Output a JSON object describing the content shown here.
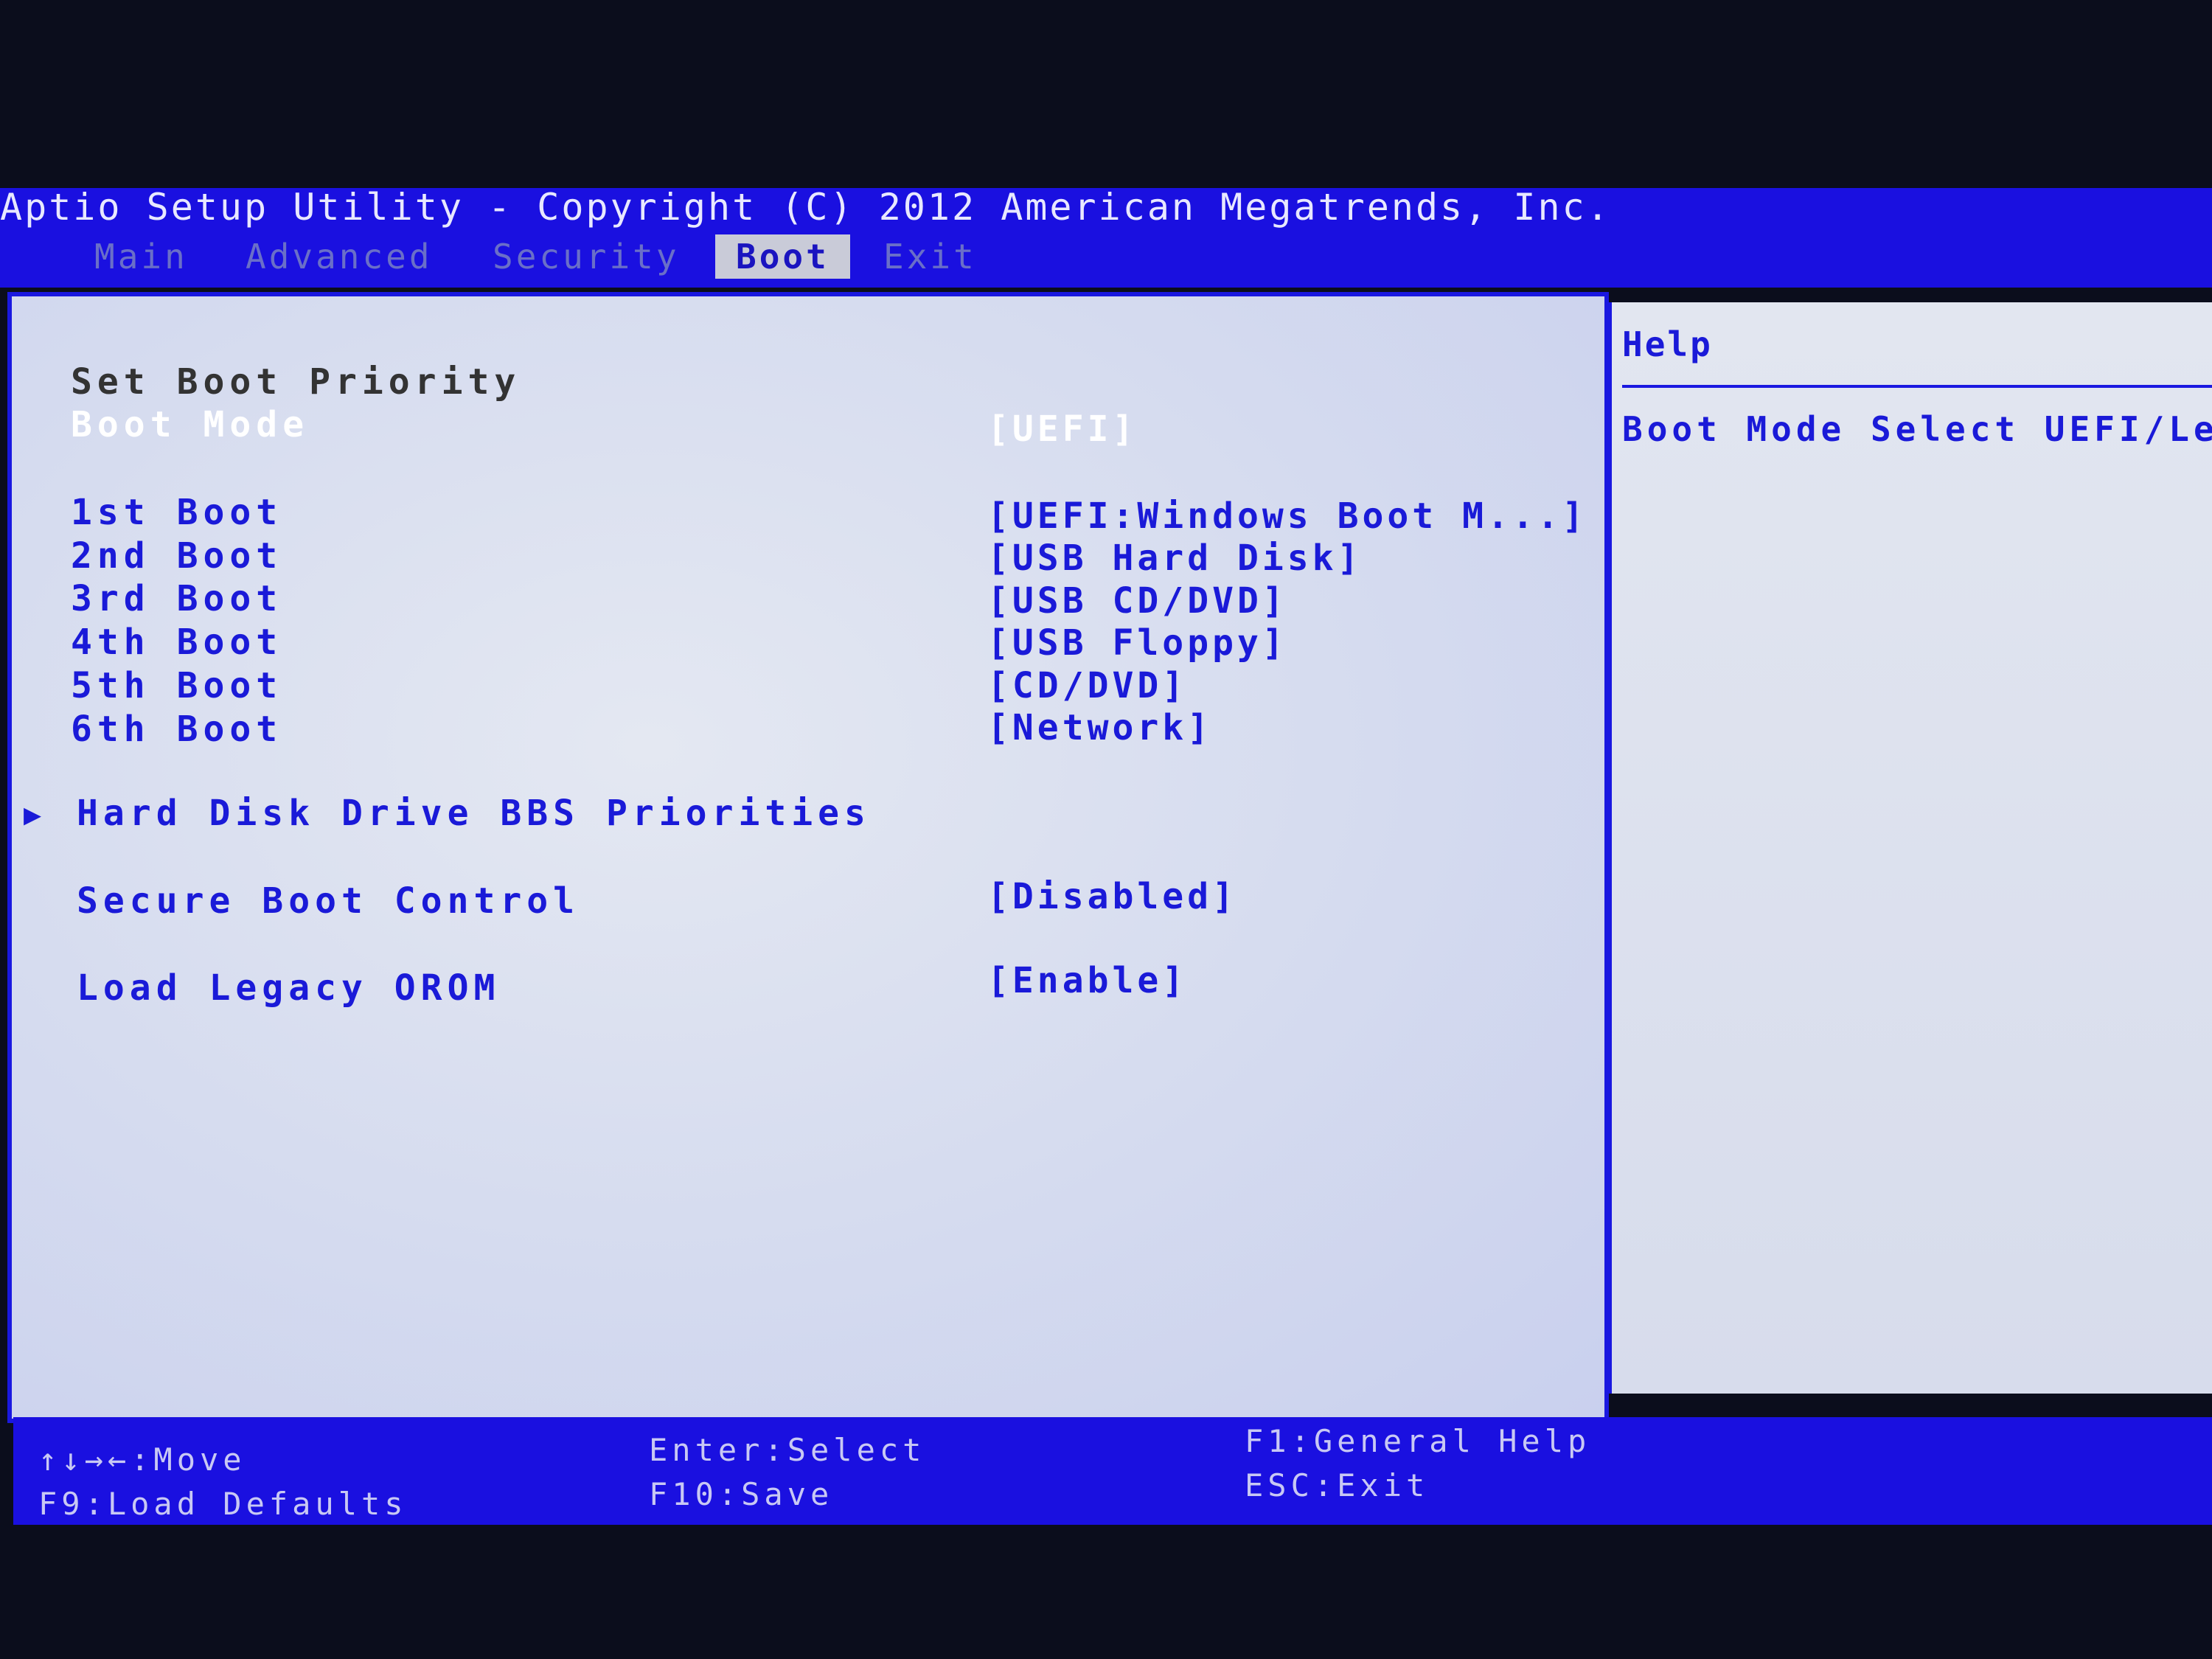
{
  "header": {
    "title": "Aptio Setup Utility - Copyright (C) 2012 American Megatrends, Inc."
  },
  "tabs": [
    {
      "label": "Main"
    },
    {
      "label": "Advanced"
    },
    {
      "label": "Security"
    },
    {
      "label": "Boot",
      "active": true
    },
    {
      "label": "Exit"
    }
  ],
  "main": {
    "section_title": "Set Boot Priority",
    "items": [
      {
        "label": "Boot Mode",
        "value": "[UEFI]",
        "selected": true
      },
      {
        "label": "1st Boot",
        "value": "[UEFI:Windows Boot M...]"
      },
      {
        "label": "2nd Boot",
        "value": "[USB Hard Disk]"
      },
      {
        "label": "3rd Boot",
        "value": "[USB CD/DVD]"
      },
      {
        "label": "4th Boot",
        "value": "[USB Floppy]"
      },
      {
        "label": "5th Boot",
        "value": "[CD/DVD]"
      },
      {
        "label": "6th Boot",
        "value": "[Network]"
      },
      {
        "label": "Hard Disk Drive BBS Priorities",
        "submenu": true,
        "icon": "triangle-right-icon"
      },
      {
        "label": "Secure Boot Control",
        "value": "[Disabled]"
      },
      {
        "label": "Load Legacy OROM",
        "value": "[Enable]"
      }
    ]
  },
  "help": {
    "title": "Help",
    "text": "Boot Mode Select UEFI/Leg"
  },
  "footer": {
    "move": "↑↓→←:Move",
    "load_defaults": "F9:Load Defaults",
    "select": "Enter:Select",
    "save": "F10:Save",
    "general_help": "F1:General Help",
    "exit": "ESC:Exit"
  },
  "colors": {
    "bar_blue": "#1a10e0",
    "text_blue": "#1a1ad8",
    "panel": "#dfe3ee",
    "selected": "#ffffff"
  }
}
